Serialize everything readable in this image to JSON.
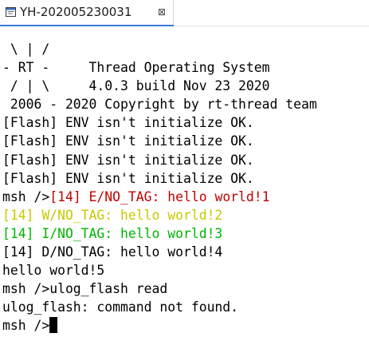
{
  "tab": {
    "title": "YH-202005230031",
    "close_glyph": "⊠",
    "icon": "terminal-window-icon"
  },
  "terminal": {
    "logo": [
      " \\ | /",
      "- RT -     Thread Operating System",
      " / | \\     4.0.3 build Nov 23 2020",
      " 2006 - 2020 Copyright by rt-thread team"
    ],
    "flash_lines": [
      "[Flash] ENV isn't initialize OK.",
      "[Flash] ENV isn't initialize OK.",
      "[Flash] ENV isn't initialize OK.",
      "[Flash] ENV isn't initialize OK."
    ],
    "prompt": "msh />",
    "log_error": "[14] E/NO_TAG: hello world!1",
    "log_warn": "[14] W/NO_TAG: hello world!2",
    "log_info": "[14] I/NO_TAG: hello world!3",
    "log_debug": "[14] D/NO_TAG: hello world!4",
    "raw_output": "hello world!5",
    "command_line": "msh />ulog_flash read",
    "error_output": "ulog_flash: command not found.",
    "final_prompt": "msh />"
  },
  "colors": {
    "error": "#c00000",
    "warn": "#c8c800",
    "info": "#00b400",
    "default": "#000000",
    "tab_accent": "#3c78d8"
  }
}
